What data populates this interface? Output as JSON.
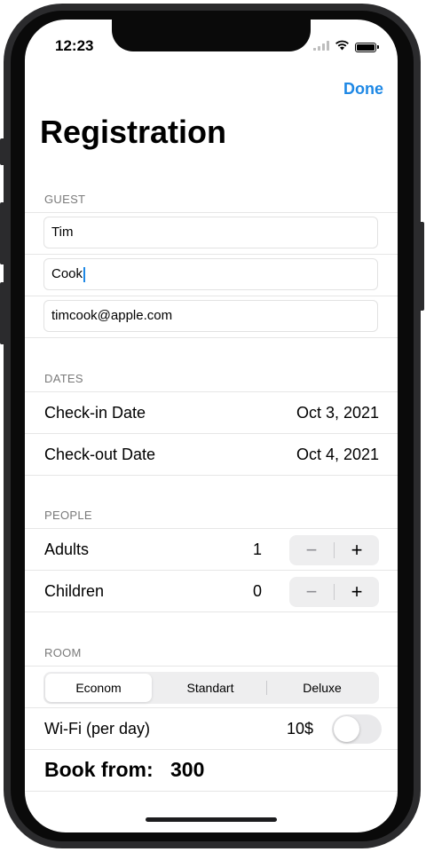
{
  "status_bar": {
    "time": "12:23"
  },
  "nav": {
    "done_label": "Done",
    "title": "Registration"
  },
  "guest": {
    "header": "GUEST",
    "first_name": "Tim",
    "last_name": "Cook",
    "email": "timcook@apple.com"
  },
  "dates": {
    "header": "DATES",
    "check_in": {
      "label": "Check-in Date",
      "value": "Oct 3, 2021"
    },
    "check_out": {
      "label": "Check-out Date",
      "value": "Oct 4, 2021"
    }
  },
  "people": {
    "header": "PEOPLE",
    "adults": {
      "label": "Adults",
      "count": "1",
      "minus": "−",
      "plus": "+"
    },
    "children": {
      "label": "Children",
      "count": "0",
      "minus": "−",
      "plus": "+"
    }
  },
  "room": {
    "header": "ROOM",
    "segments": [
      "Econom",
      "Standart",
      "Deluxe"
    ],
    "selected_segment": "Econom",
    "wifi": {
      "label": "Wi-Fi (per day)",
      "price": "10$",
      "enabled": false
    }
  },
  "booking": {
    "label": "Book from:",
    "value": "300"
  },
  "colors": {
    "accent": "#1e88e5",
    "separator": "#e6e6e6",
    "control_bg": "#eeeeef"
  }
}
